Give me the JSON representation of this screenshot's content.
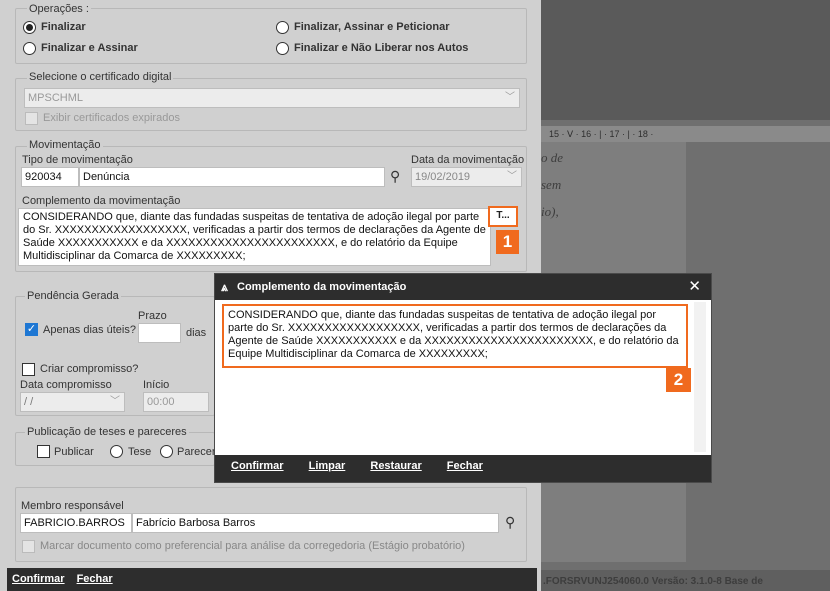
{
  "operacoes": {
    "title": "Operações :",
    "finalizar": "Finalizar",
    "finalizar_assinar": "Finalizar e Assinar",
    "finalizar_assinar_peticionar": "Finalizar, Assinar e Peticionar",
    "finalizar_nao_liberar": "Finalizar e Não Liberar nos Autos"
  },
  "certificado": {
    "title": "Selecione o certificado digital",
    "value": "MPSCHML",
    "expirados": "Exibir certificados expirados"
  },
  "movimentacao": {
    "title": "Movimentação",
    "tipo_label": "Tipo de movimentação",
    "codigo": "920034",
    "tipo": "Denúncia",
    "data_label": "Data da movimentação",
    "data": "19/02/2019",
    "complemento_label": "Complemento da movimentação",
    "complemento": "CONSIDERANDO que, diante das fundadas suspeitas de tentativa de adoção ilegal por parte do Sr. XXXXXXXXXXXXXXXXXX, verificadas a partir dos termos de declarações da Agente de Saúde XXXXXXXXXXX e da XXXXXXXXXXXXXXXXXXXXXXX, e do relatório da Equipe Multidisciplinar da Comarca de XXXXXXXXX;",
    "expand_button": "T..."
  },
  "pendencia": {
    "title": "Pendência Gerada",
    "apenas_uteis": "Apenas dias úteis?",
    "prazo_label": "Prazo",
    "dias": "dias",
    "criar_compromisso": "Criar compromisso?",
    "data_compromisso": "Data compromisso",
    "data_value": " / /",
    "inicio": "Início",
    "inicio_value": "00:00"
  },
  "publicacao": {
    "title": "Publicação de teses e pareceres",
    "publicar": "Publicar",
    "tese": "Tese",
    "parecer": "Parecer"
  },
  "membro": {
    "title": "Membro responsável",
    "login": "FABRICIO.BARROS",
    "nome": "Fabrício Barbosa Barros",
    "marcar": "Marcar documento como preferencial para análise da corregedoria (Estágio probatório)"
  },
  "footer": {
    "confirmar": "Confirmar",
    "fechar": "Fechar"
  },
  "badges": {
    "one": "1",
    "two": "2"
  },
  "popup": {
    "title": "Complemento da movimentação",
    "close": "✕",
    "text": "CONSIDERANDO que, diante das fundadas suspeitas de tentativa de adoção ilegal por parte do Sr. XXXXXXXXXXXXXXXXXX, verificadas a partir dos termos de declarações da Agente de Saúde XXXXXXXXXXX e da XXXXXXXXXXXXXXXXXXXXXXX, e do relatório da Equipe Multidisciplinar da Comarca de XXXXXXXXX;",
    "confirmar": "Confirmar",
    "limpar": "Limpar",
    "restaurar": "Restaurar",
    "fechar": "Fechar"
  },
  "background": {
    "ruler": "15 · ꓦ · 16 · | · 17 · | · 18 ·",
    "line1": "o de",
    "line2": "sem",
    "line3": "io),",
    "status": ".FORSRVUNJ254060.0      Versão: 3.1.0-8      Base de"
  },
  "colors": {
    "accent": "#f06a1e",
    "dark_bar": "#2d2d2d",
    "check_blue": "#1e77d3"
  }
}
